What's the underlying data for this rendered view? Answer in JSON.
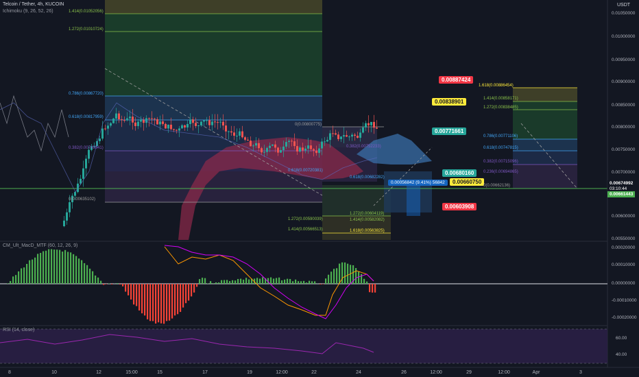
{
  "header": {
    "symbol_title": "Telcoin / Tether, 4h, KUCOIN",
    "indicator_ichimoku": "Ichimoku (9, 26, 52, 26)",
    "currency": "USDT"
  },
  "panes": {
    "macd_label": "CM_Ult_MacD_MTF (60, 12, 26, 9)",
    "rsi_label": "RSI (14, close)"
  },
  "price_axis": [
    {
      "label": "0.01050000"
    },
    {
      "label": "0.01000000"
    },
    {
      "label": "0.00950000"
    },
    {
      "label": "0.00900000"
    },
    {
      "label": "0.00850000"
    },
    {
      "label": "0.00800000"
    },
    {
      "label": "0.00750000"
    },
    {
      "label": "0.00700000"
    },
    {
      "label": "0.00600000"
    },
    {
      "label": "0.00550000"
    }
  ],
  "price_badges": {
    "current_price": "0.00674992",
    "countdown": "03:10:44",
    "green_level": "0.00661443",
    "wide_price": "0.00650000"
  },
  "macd_axis": [
    "0.00020000",
    "0.00010000",
    "0.00000000",
    "-0.00010000",
    "-0.00020000"
  ],
  "rsi_axis": [
    "60.00",
    "40.00"
  ],
  "time_axis": [
    "8",
    "10",
    "12",
    "15:00",
    "15",
    "17",
    "19",
    "12:00",
    "22",
    "24",
    "26",
    "12:00",
    "29",
    "12:00",
    "Apr",
    "3"
  ],
  "tags": [
    {
      "text": "0.00887424",
      "color": "#f23645",
      "fg": "#ffffff"
    },
    {
      "text": "0.00838901",
      "color": "#ffeb3b",
      "fg": "#131722"
    },
    {
      "text": "0.00771661",
      "color": "#26a69a",
      "fg": "#ffffff"
    },
    {
      "text": "0.00680160",
      "color": "#26a69a",
      "fg": "#ffffff"
    },
    {
      "text": "0.00660750",
      "color": "#ffeb3b",
      "fg": "#131722"
    },
    {
      "text": "0.00603908",
      "color": "#f23645",
      "fg": "#ffffff"
    }
  ],
  "measure_label": "0.00056842 (9.41%) 56842",
  "fib_labels": {
    "left_top": [
      "1.414(0.01052056)",
      "1.272(0.01010724)",
      "0.786(0.00867720)",
      "0.618(0.00817959)",
      "0.382(0.00749541)",
      "0(0.00635102)"
    ],
    "mid": [
      "0(0.00800775)",
      "0.382(0.00752233)",
      "0.618(0.00720381)",
      "0.618(0.00682282)",
      "1.272(0.00604119)",
      "1.272(0.00590039)",
      "1.414(0.00582082)",
      "1.414(0.00566513)",
      "1.618(0.00563825)"
    ],
    "right": [
      "1.618(0.00886454)",
      "1.414(0.00858171)",
      "1.272(0.00838485)",
      "0.786(0.00771106)",
      "0.618(0.00747815)",
      "0.382(0.00715096)",
      "0.236(0.00694865)",
      "0(0.00662136)"
    ]
  },
  "colors": {
    "background": "#131722",
    "up_candle": "#26a69a",
    "down_candle": "#ef5350",
    "cloud_bear": "#8e2a4a",
    "fib_blue": "#2962ff",
    "fib_green": "#4caf50"
  }
}
